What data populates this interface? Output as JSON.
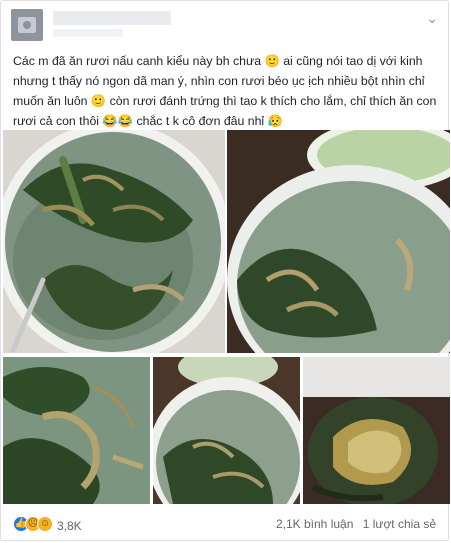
{
  "post": {
    "caption": "Các m đã ăn rươi nấu canh kiểu này bh chưa 🙂 ai cũng nói tao dị với kinh nhưng t thấy nó ngon dã man ý, nhìn con rươi béo ục ịch nhiều bột nhìn chỉ muốn ăn luôn 🙂 còn rươi đánh trứng thì tao k thích cho lắm, chỉ thích ăn con rươi cả con thôi 😂😂 chắc t k cô đơn đâu nhỉ 😥",
    "menu_icon": "chevron-down-icon"
  },
  "reactions": {
    "icons": [
      "like-icon",
      "sad-icon",
      "haha-icon"
    ],
    "count": "3,8K"
  },
  "stats": {
    "comments": "2,1K bình luận",
    "shares": "1 lượt chia sẻ"
  },
  "colors": {
    "text": "#1d2129",
    "meta": "#606770",
    "like_blue": "#1877f2",
    "soup_broth": "#8a9e8a",
    "greens": "#3d5a2c",
    "bowl": "#f4f4f4"
  }
}
